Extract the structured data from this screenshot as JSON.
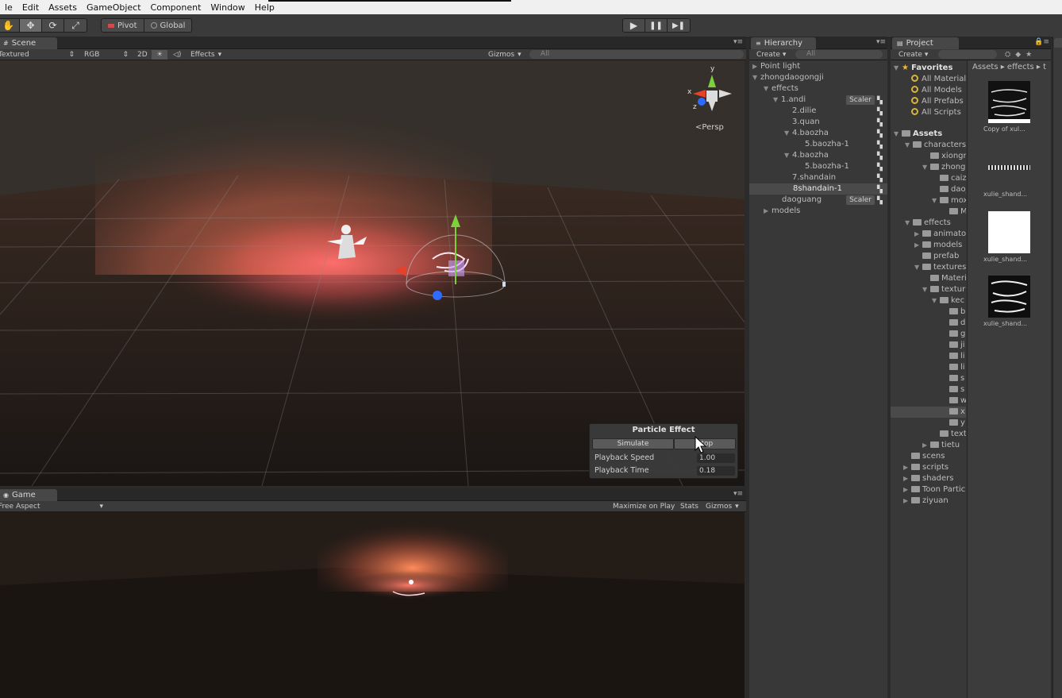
{
  "menu": [
    "le",
    "Edit",
    "Assets",
    "GameObject",
    "Component",
    "Window",
    "Help"
  ],
  "toolbar": {
    "pivot_label": "Pivot",
    "global_label": "Global",
    "play_icon": "play-icon",
    "pause_icon": "pause-icon",
    "step_icon": "step-icon"
  },
  "scene": {
    "tab_label": "Scene",
    "shading_mode": "Textured",
    "render_mode": "RGB",
    "mode_2d": "2D",
    "effects_label": "Effects",
    "gizmos_label": "Gizmos",
    "search_placeholder": "All",
    "persp_label": "Persp",
    "axis_y": "y",
    "axis_x": "x",
    "axis_z": "z"
  },
  "particle_effect": {
    "title": "Particle Effect",
    "simulate_label": "Simulate",
    "stop_label": "Stop",
    "playback_speed_label": "Playback Speed",
    "playback_speed_value": "1.00",
    "playback_time_label": "Playback Time",
    "playback_time_value": "0.18"
  },
  "game": {
    "tab_label": "Game",
    "aspect_label": "Free Aspect",
    "maximize_label": "Maximize on Play",
    "stats_label": "Stats",
    "gizmos_label": "Gizmos"
  },
  "hierarchy": {
    "tab_label": "Hierarchy",
    "create_label": "Create",
    "search_placeholder": "All",
    "scaler_label": "Scaler",
    "items": [
      {
        "label": "Point light"
      },
      {
        "label": "zhongdaogongji"
      },
      {
        "label": "effects"
      },
      {
        "label": "1.andi"
      },
      {
        "label": "2.dilie"
      },
      {
        "label": "3.quan"
      },
      {
        "label": "4.baozha"
      },
      {
        "label": "5.baozha-1"
      },
      {
        "label": "4.baozha"
      },
      {
        "label": "5.baozha-1"
      },
      {
        "label": "7.shandain"
      },
      {
        "label": "8shandain-1"
      },
      {
        "label": "daoguang"
      },
      {
        "label": "models"
      }
    ]
  },
  "project": {
    "tab_label": "Project",
    "create_label": "Create",
    "breadcrumb": "Assets ▸ effects ▸ t",
    "favorites": {
      "title": "Favorites",
      "items": [
        "All Material",
        "All Models",
        "All Prefabs",
        "All Scripts"
      ]
    },
    "assets_title": "Assets",
    "tree": [
      "characters",
      "xiongma",
      "zhongda",
      "caizhi",
      "dao_g",
      "moxin",
      "Mat",
      "effects",
      "animator",
      "models",
      "prefab",
      "textures",
      "Materi",
      "textur",
      "kec",
      "b",
      "d",
      "g",
      "ji",
      "li",
      "li",
      "s",
      "s",
      "w",
      "x",
      "y",
      "text",
      "tietu",
      "scens",
      "scripts",
      "shaders",
      "Toon Partic",
      "ziyuan"
    ],
    "thumbnails": [
      {
        "label": "Copy of xul..."
      },
      {
        "label": "xulie_shand..."
      },
      {
        "label": "xulie_shand..."
      },
      {
        "label": "xulie_shand..."
      }
    ]
  },
  "colors": {
    "accent_glow": "#ff7a45",
    "gizmo_green": "#7bd13b",
    "gizmo_red": "#e5412b",
    "gizmo_blue": "#2e6bff",
    "favorites_star": "#f0b83a"
  }
}
